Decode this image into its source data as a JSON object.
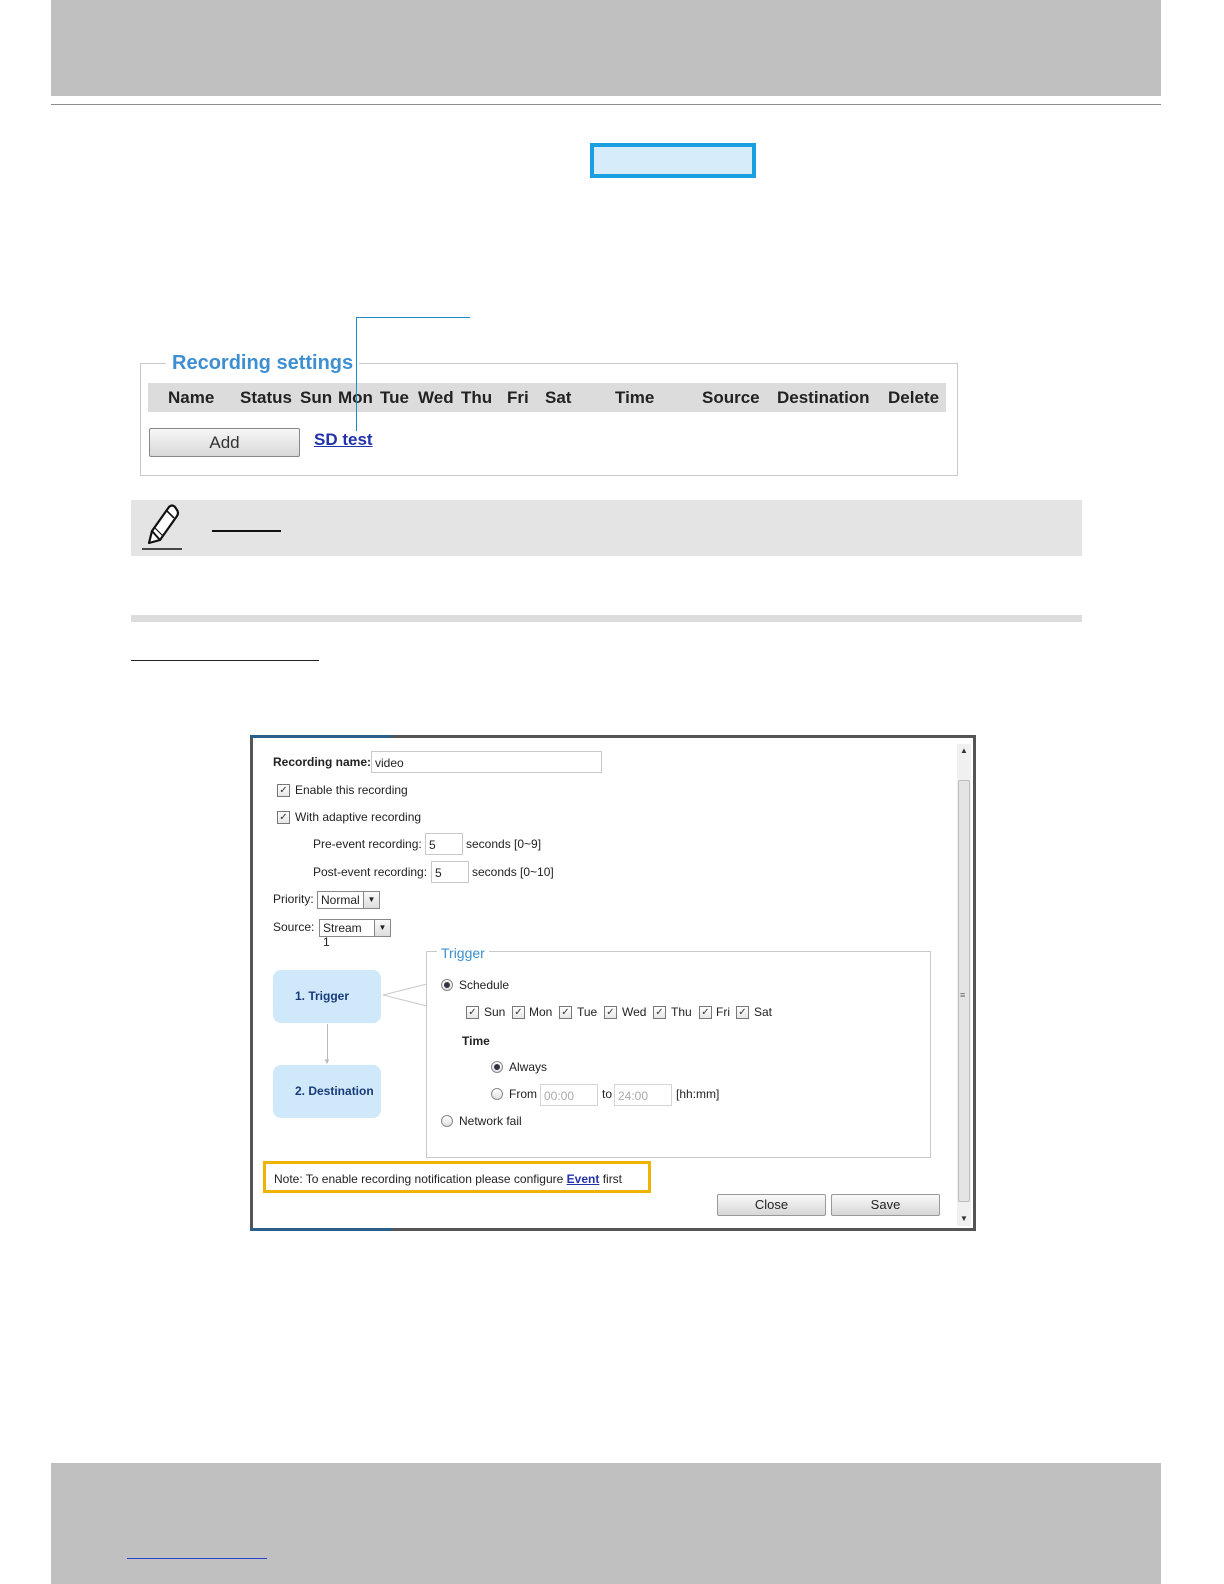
{
  "recording_settings": {
    "legend": "Recording settings",
    "columns": [
      "Name",
      "Status",
      "Sun",
      "Mon",
      "Tue",
      "Wed",
      "Thu",
      "Fri",
      "Sat",
      "Time",
      "Source",
      "Destination",
      "Delete"
    ],
    "add_label": "Add",
    "entry_link": "SD test"
  },
  "dialog": {
    "recording_name_label": "Recording name:",
    "recording_name_value": "video",
    "enable_label": "Enable this recording",
    "adaptive_label": "With adaptive recording",
    "pre_event_label": "Pre-event recording:",
    "pre_event_value": "5",
    "pre_event_unit": "seconds [0~9]",
    "post_event_label": "Post-event recording:",
    "post_event_value": "5",
    "post_event_unit": "seconds [0~10]",
    "priority_label": "Priority:",
    "priority_value": "Normal",
    "source_label": "Source:",
    "source_value": "Stream 1",
    "steps": [
      "1. Trigger",
      "2. Destination"
    ],
    "trigger": {
      "legend": "Trigger",
      "schedule_label": "Schedule",
      "days": [
        "Sun",
        "Mon",
        "Tue",
        "Wed",
        "Thu",
        "Fri",
        "Sat"
      ],
      "time_label": "Time",
      "always_label": "Always",
      "from_label": "From",
      "from_value": "00:00",
      "to_label": "to",
      "to_value": "24:00",
      "format_hint": "[hh:mm]",
      "network_fail_label": "Network fail"
    },
    "note_prefix": "Note: To enable recording notification please configure",
    "note_link": "Event",
    "note_suffix": "first",
    "close_label": "Close",
    "save_label": "Save"
  }
}
